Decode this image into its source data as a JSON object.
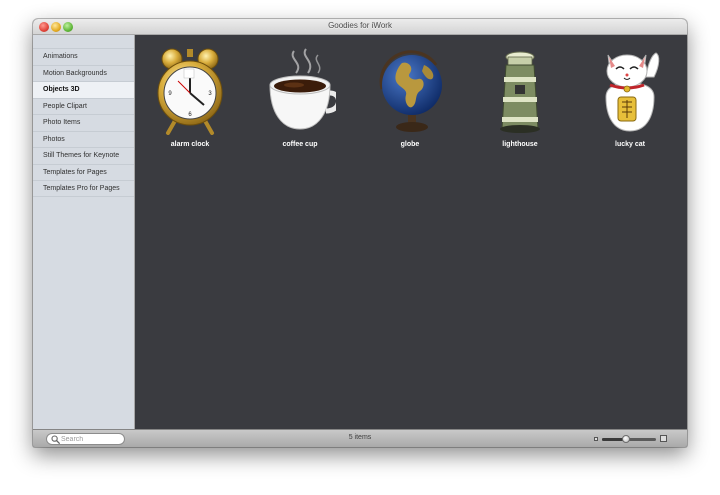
{
  "window": {
    "title": "Goodies for iWork"
  },
  "sidebar": {
    "items": [
      {
        "label": "Animations",
        "selected": false
      },
      {
        "label": "Motion Backgrounds",
        "selected": false
      },
      {
        "label": "Objects 3D",
        "selected": true
      },
      {
        "label": "People Clipart",
        "selected": false
      },
      {
        "label": "Photo Items",
        "selected": false
      },
      {
        "label": "Photos",
        "selected": false
      },
      {
        "label": "Still Themes for Keynote",
        "selected": false
      },
      {
        "label": "Templates for Pages",
        "selected": false
      },
      {
        "label": "Templates Pro for Pages",
        "selected": false
      }
    ]
  },
  "content": {
    "items": [
      {
        "label": "alarm clock",
        "icon": "alarm-clock-icon"
      },
      {
        "label": "coffee cup",
        "icon": "coffee-cup-icon"
      },
      {
        "label": "globe",
        "icon": "globe-icon"
      },
      {
        "label": "lighthouse",
        "icon": "lighthouse-icon"
      },
      {
        "label": "lucky cat",
        "icon": "lucky-cat-icon"
      }
    ]
  },
  "bottombar": {
    "search_placeholder": "Search",
    "item_count": "5 items",
    "zoom_level": 0.45
  },
  "colors": {
    "content_bg": "#3a3b40",
    "sidebar_bg": "#d6dbe2",
    "label_text": "#ffffff"
  }
}
